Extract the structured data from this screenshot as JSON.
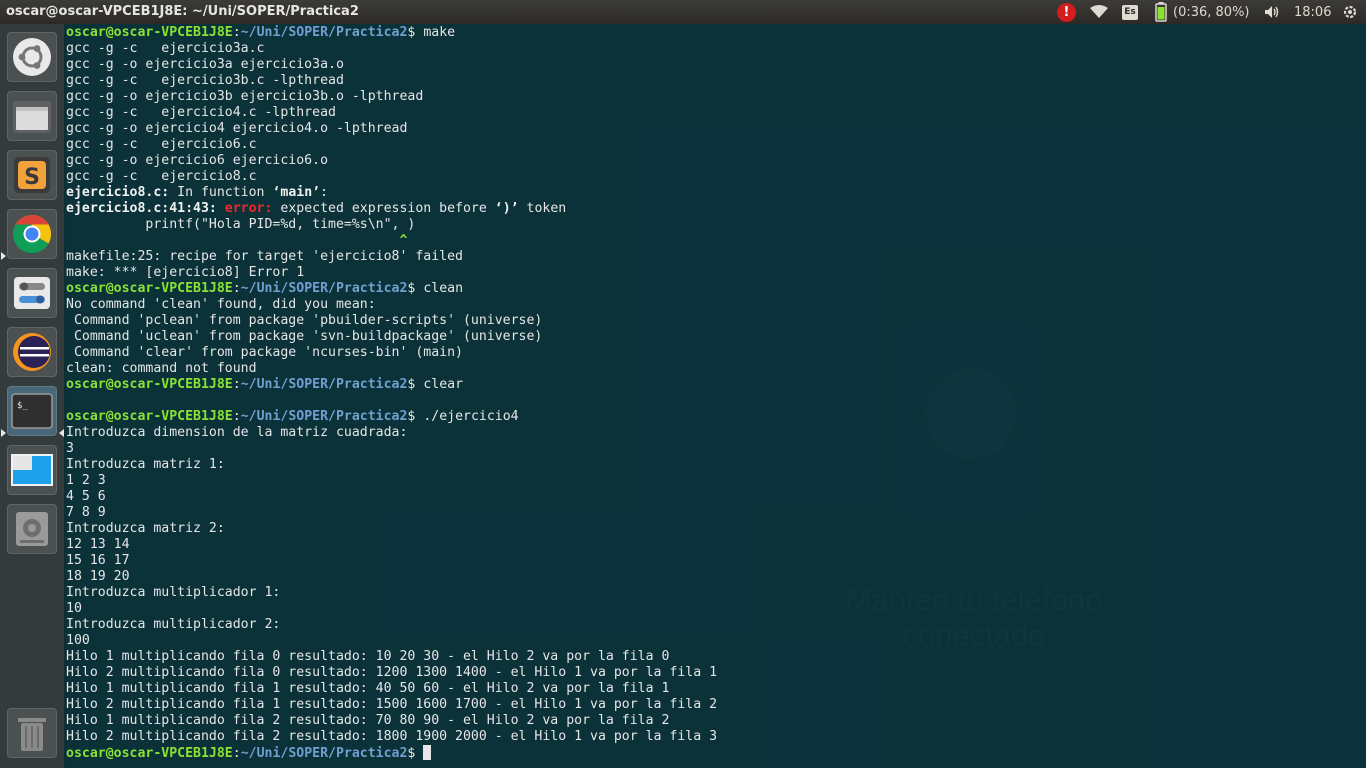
{
  "window": {
    "title": "oscar@oscar-VPCEB1J8E: ~/Uni/SOPER/Practica2"
  },
  "tray": {
    "alert_icon": "alert-icon",
    "wifi_icon": "wifi-icon",
    "keyboard_layout": "Es",
    "battery_status": "(0:36, 80%)",
    "volume_icon": "volume-icon",
    "clock": "18:06",
    "power_icon": "power-gear-icon"
  },
  "launcher": {
    "items": [
      {
        "name": "dash-home",
        "icon": "ubuntu-logo-icon"
      },
      {
        "name": "files",
        "icon": "files-icon"
      },
      {
        "name": "sublime-text",
        "icon": "sublime-text-icon",
        "letter": "S"
      },
      {
        "name": "chrome",
        "icon": "chrome-icon"
      },
      {
        "name": "system-settings",
        "icon": "settings-toggle-icon"
      },
      {
        "name": "eclipse",
        "icon": "eclipse-icon"
      },
      {
        "name": "terminal",
        "icon": "terminal-icon",
        "prompt": "$_"
      },
      {
        "name": "workspaces",
        "icon": "workspace-icon"
      },
      {
        "name": "disk",
        "icon": "disk-icon"
      },
      {
        "name": "trash",
        "icon": "trash-icon"
      }
    ]
  },
  "background": {
    "title_line1": "Mantén tu teléfono",
    "title_line2": "conectado"
  },
  "terminal": {
    "prompt_user": "oscar@oscar-VPCEB1J8E",
    "prompt_sep": ":",
    "prompt_path": "~/Uni/SOPER/Practica2",
    "prompt_dollar": "$ ",
    "lines": [
      {
        "type": "prompt",
        "cmd": "make"
      },
      {
        "type": "out",
        "text": "gcc -g -c   ejercicio3a.c"
      },
      {
        "type": "out",
        "text": "gcc -g -o ejercicio3a ejercicio3a.o"
      },
      {
        "type": "out",
        "text": "gcc -g -c   ejercicio3b.c -lpthread"
      },
      {
        "type": "out",
        "text": "gcc -g -o ejercicio3b ejercicio3b.o -lpthread"
      },
      {
        "type": "out",
        "text": "gcc -g -c   ejercicio4.c -lpthread"
      },
      {
        "type": "out",
        "text": "gcc -g -o ejercicio4 ejercicio4.o -lpthread"
      },
      {
        "type": "out",
        "text": "gcc -g -c   ejercicio6.c"
      },
      {
        "type": "out",
        "text": "gcc -g -o ejercicio6 ejercicio6.o"
      },
      {
        "type": "out",
        "text": "gcc -g -c   ejercicio8.c"
      },
      {
        "type": "func",
        "file": "ejercicio8.c:",
        "text": " In function ",
        "fname": "‘main’",
        "end": ":"
      },
      {
        "type": "error",
        "loc": "ejercicio8.c:41:43:",
        "label": " error:",
        "text": " expected expression before ",
        "tok": "‘)’",
        "end": " token"
      },
      {
        "type": "out",
        "text": "          printf(\"Hola PID=%d, time=%s\\n\", )"
      },
      {
        "type": "caret",
        "text": "                                          ^"
      },
      {
        "type": "out",
        "text": "makefile:25: recipe for target 'ejercicio8' failed"
      },
      {
        "type": "out",
        "text": "make: *** [ejercicio8] Error 1"
      },
      {
        "type": "prompt",
        "cmd": "clean"
      },
      {
        "type": "out",
        "text": "No command 'clean' found, did you mean:"
      },
      {
        "type": "out",
        "text": " Command 'pclean' from package 'pbuilder-scripts' (universe)"
      },
      {
        "type": "out",
        "text": " Command 'uclean' from package 'svn-buildpackage' (universe)"
      },
      {
        "type": "out",
        "text": " Command 'clear' from package 'ncurses-bin' (main)"
      },
      {
        "type": "out",
        "text": "clean: command not found"
      },
      {
        "type": "prompt",
        "cmd": "clear"
      },
      {
        "type": "out",
        "text": ""
      },
      {
        "type": "prompt",
        "cmd": "./ejercicio4"
      },
      {
        "type": "out",
        "text": "Introduzca dimension de la matriz cuadrada:"
      },
      {
        "type": "out",
        "text": "3"
      },
      {
        "type": "out",
        "text": "Introduzca matriz 1:"
      },
      {
        "type": "out",
        "text": "1 2 3"
      },
      {
        "type": "out",
        "text": "4 5 6"
      },
      {
        "type": "out",
        "text": "7 8 9"
      },
      {
        "type": "out",
        "text": "Introduzca matriz 2:"
      },
      {
        "type": "out",
        "text": "12 13 14"
      },
      {
        "type": "out",
        "text": "15 16 17"
      },
      {
        "type": "out",
        "text": "18 19 20"
      },
      {
        "type": "out",
        "text": "Introduzca multiplicador 1:"
      },
      {
        "type": "out",
        "text": "10"
      },
      {
        "type": "out",
        "text": "Introduzca multiplicador 2:"
      },
      {
        "type": "out",
        "text": "100"
      },
      {
        "type": "out",
        "text": "Hilo 1 multiplicando fila 0 resultado: 10 20 30 - el Hilo 2 va por la fila 0"
      },
      {
        "type": "out",
        "text": "Hilo 2 multiplicando fila 0 resultado: 1200 1300 1400 - el Hilo 1 va por la fila 1"
      },
      {
        "type": "out",
        "text": "Hilo 1 multiplicando fila 1 resultado: 40 50 60 - el Hilo 2 va por la fila 1"
      },
      {
        "type": "out",
        "text": "Hilo 2 multiplicando fila 1 resultado: 1500 1600 1700 - el Hilo 1 va por la fila 2"
      },
      {
        "type": "out",
        "text": "Hilo 1 multiplicando fila 2 resultado: 70 80 90 - el Hilo 2 va por la fila 2"
      },
      {
        "type": "out",
        "text": "Hilo 2 multiplicando fila 2 resultado: 1800 1900 2000 - el Hilo 1 va por la fila 3"
      },
      {
        "type": "prompt_cursor",
        "cmd": ""
      }
    ]
  }
}
